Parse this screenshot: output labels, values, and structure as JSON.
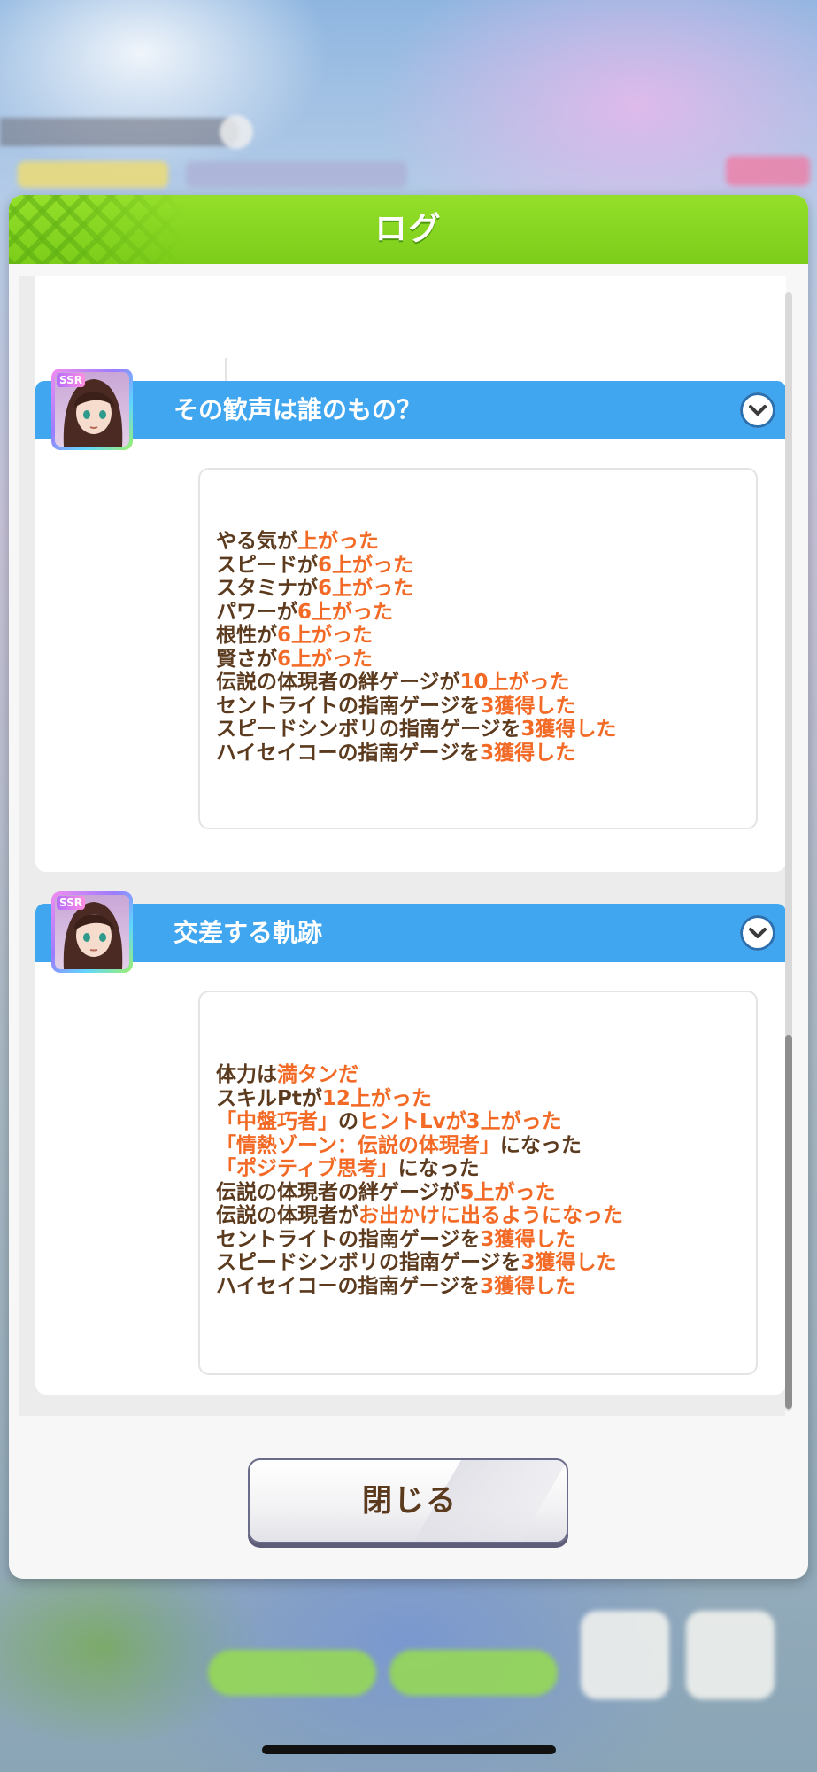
{
  "dialog": {
    "title": "ログ",
    "close_label": "閉じる"
  },
  "entries": [
    {
      "title": "その歓声は誰のもの？",
      "badge": "SSR",
      "lines": [
        {
          "prefix": "やる気が",
          "highlight": "上がった",
          "suffix": ""
        },
        {
          "prefix": "スピードが",
          "highlight": "6上がった",
          "suffix": ""
        },
        {
          "prefix": "スタミナが",
          "highlight": "6上がった",
          "suffix": ""
        },
        {
          "prefix": "パワーが",
          "highlight": "6上がった",
          "suffix": ""
        },
        {
          "prefix": "根性が",
          "highlight": "6上がった",
          "suffix": ""
        },
        {
          "prefix": "賢さが",
          "highlight": "6上がった",
          "suffix": ""
        },
        {
          "prefix": "伝説の体現者の絆ゲージが",
          "highlight": "10上がった",
          "suffix": ""
        },
        {
          "prefix": "セントライトの指南ゲージを",
          "highlight": "3獲得した",
          "suffix": ""
        },
        {
          "prefix": "スピードシンボリの指南ゲージを",
          "highlight": "3獲得した",
          "suffix": ""
        },
        {
          "prefix": "ハイセイコーの指南ゲージを",
          "highlight": "3獲得した",
          "suffix": ""
        }
      ]
    },
    {
      "title": "交差する軌跡",
      "badge": "SSR",
      "lines": [
        {
          "prefix": "体力は",
          "highlight": "満タンだ",
          "suffix": ""
        },
        {
          "prefix": "スキルPtが",
          "highlight": "12上がった",
          "suffix": ""
        },
        {
          "prefix": "",
          "highlight": "「中盤巧者」",
          "suffix": "の",
          "highlight2": "ヒントLvが3上がった"
        },
        {
          "prefix": "",
          "highlight": "「情熱ゾーン：伝説の体現者」",
          "suffix": "になった"
        },
        {
          "prefix": "",
          "highlight": "「ポジティブ思考」",
          "suffix": "になった"
        },
        {
          "prefix": "伝説の体現者の絆ゲージが",
          "highlight": "5上がった",
          "suffix": ""
        },
        {
          "prefix": "伝説の体現者が",
          "highlight": "お出かけに出るようになった",
          "suffix": ""
        },
        {
          "prefix": "セントライトの指南ゲージを",
          "highlight": "3獲得した",
          "suffix": ""
        },
        {
          "prefix": "スピードシンボリの指南ゲージを",
          "highlight": "3獲得した",
          "suffix": ""
        },
        {
          "prefix": "ハイセイコーの指南ゲージを",
          "highlight": "3獲得した",
          "suffix": ""
        }
      ]
    }
  ],
  "colors": {
    "header_green": "#7ccd1a",
    "entry_blue": "#3fa6ef",
    "text_brown": "#5b3a1e",
    "highlight_orange": "#f26a25"
  }
}
